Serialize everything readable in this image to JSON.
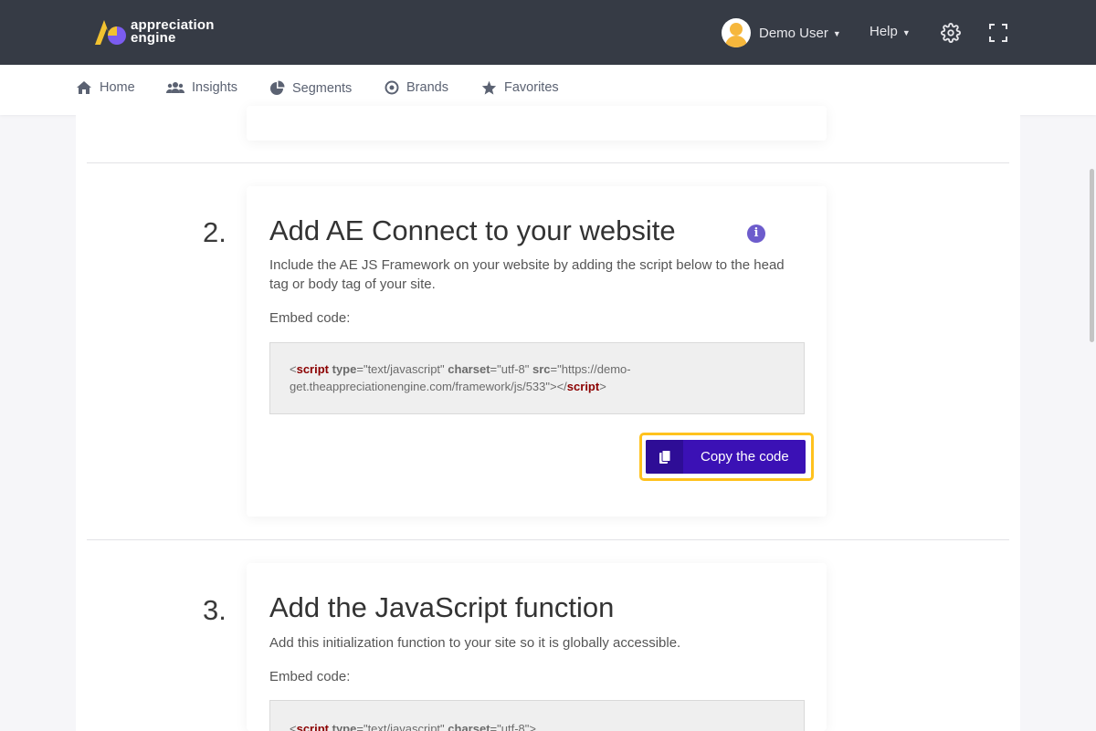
{
  "header": {
    "logo_text": [
      "appreciation",
      "engine"
    ],
    "user_name": "Demo User",
    "help_label": "Help"
  },
  "nav": {
    "items": [
      {
        "label": "Home",
        "icon": "home-icon"
      },
      {
        "label": "Insights",
        "icon": "users-icon"
      },
      {
        "label": "Segments",
        "icon": "pie-chart-icon"
      },
      {
        "label": "Brands",
        "icon": "target-icon"
      },
      {
        "label": "Favorites",
        "icon": "star-icon"
      }
    ]
  },
  "steps": [
    {
      "number": "2.",
      "title": "Add AE Connect to your website",
      "description": "Include the AE JS Framework on your website by adding the script below to the head tag or body tag of your site.",
      "embed_label": "Embed code:",
      "code": {
        "open_tag": "script",
        "type_attr": "type",
        "type_val": "\"text/javascript\"",
        "charset_attr": "charset",
        "charset_val": "\"utf-8\"",
        "src_attr": "src",
        "src_val_1": "\"https://demo-",
        "src_val_2": "get.theappreciationengine.com/framework/js/533\"",
        "close_tag": "script"
      },
      "copy_label": "Copy the code"
    },
    {
      "number": "3.",
      "title": "Add the JavaScript function",
      "description": "Add this initialization function to your site so it is globally accessible.",
      "embed_label": "Embed code:",
      "code": {
        "open_tag": "script",
        "type_attr": "type",
        "type_val": "\"text/javascript\"",
        "charset_attr": "charset",
        "charset_val": "\"utf-8\""
      }
    }
  ],
  "colors": {
    "topbar": "#363b45",
    "accent": "#3b11b5",
    "highlight": "#ffc21e",
    "info": "#6d5ccc"
  }
}
